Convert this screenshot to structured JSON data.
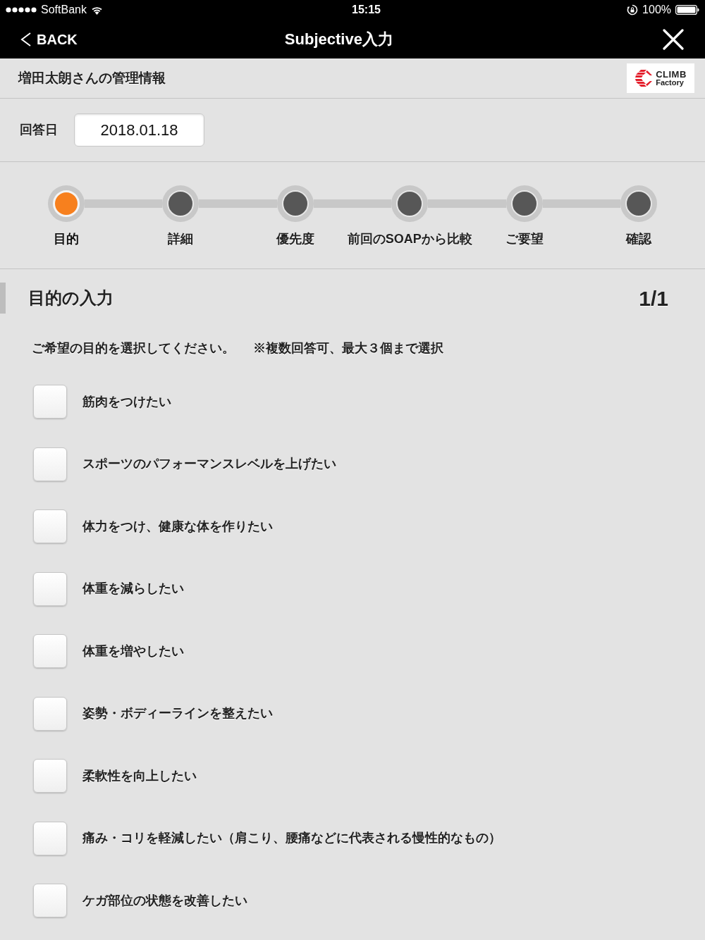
{
  "status_bar": {
    "carrier": "SoftBank",
    "time": "15:15",
    "battery": "100%"
  },
  "nav_bar": {
    "back_label": "BACK",
    "title": "Subjective入力"
  },
  "header": {
    "title": "増田太朗さんの管理情報",
    "logo": {
      "line_1": "CLIMB",
      "line_2": "Factory"
    }
  },
  "answer_date": {
    "label": "回答日",
    "value": "2018.01.18"
  },
  "steps": [
    {
      "label": "目的",
      "selected": true
    },
    {
      "label": "詳細",
      "selected": false
    },
    {
      "label": "優先度",
      "selected": false
    },
    {
      "label": "前回のSOAPから比較",
      "selected": false
    },
    {
      "label": "ご要望",
      "selected": false
    },
    {
      "label": "確認",
      "selected": false
    }
  ],
  "section": {
    "title": "目的の入力",
    "page": "1/1",
    "instruction": "ご希望の目的を選択してください。",
    "note": "※複数回答可、最大３個まで選択"
  },
  "options": [
    {
      "label": "筋肉をつけたい",
      "checked": false
    },
    {
      "label": "スポーツのパフォーマンスレベルを上げたい",
      "checked": false
    },
    {
      "label": "体力をつけ、健康な体を作りたい",
      "checked": false
    },
    {
      "label": "体重を減らしたい",
      "checked": false
    },
    {
      "label": "体重を増やしたい",
      "checked": false
    },
    {
      "label": "姿勢・ボディーラインを整えたい",
      "checked": false
    },
    {
      "label": "柔軟性を向上したい",
      "checked": false
    },
    {
      "label": "痛み・コリを軽減したい（肩こり、腰痛などに代表される慢性的なもの）",
      "checked": false
    },
    {
      "label": "ケガ部位の状態を改善したい",
      "checked": false
    }
  ]
}
